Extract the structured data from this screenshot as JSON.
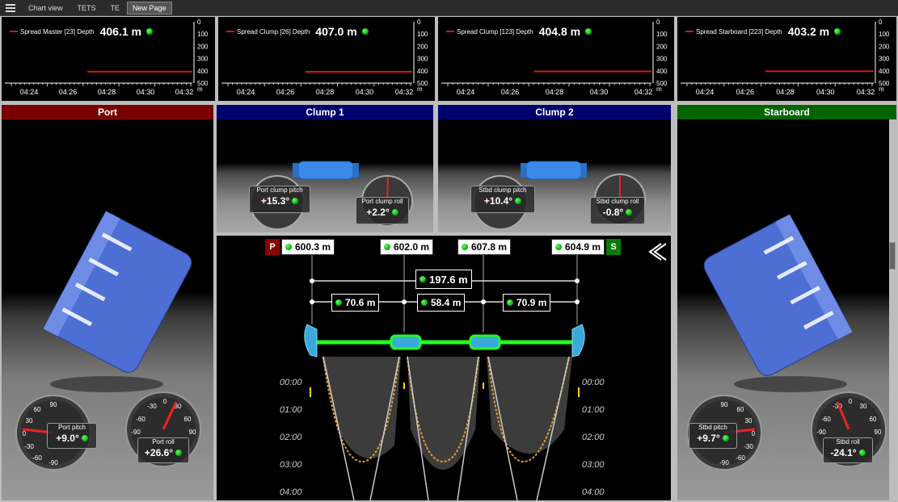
{
  "menu": {
    "tabs": [
      "Chart view",
      "TETS",
      "TE",
      "New Page"
    ],
    "active": "New Page"
  },
  "charts": [
    {
      "label": "Spread Master [23] Depth",
      "value": "406.1 m",
      "times": [
        "04:24",
        "04:26",
        "04:28",
        "04:30",
        "04:32"
      ],
      "yticks": [
        "0",
        "100",
        "200",
        "300",
        "400",
        "500"
      ],
      "unit": "m",
      "depth": 406.1
    },
    {
      "label": "Spread Clump [26] Depth",
      "value": "407.0 m",
      "times": [
        "04:24",
        "04:26",
        "04:28",
        "04:30",
        "04:32"
      ],
      "yticks": [
        "0",
        "100",
        "200",
        "300",
        "400",
        "500"
      ],
      "unit": "m",
      "depth": 407.0
    },
    {
      "label": "Spread Clump [123] Depth",
      "value": "404.8 m",
      "times": [
        "04:24",
        "04:26",
        "04:28",
        "04:30",
        "04:32"
      ],
      "yticks": [
        "0",
        "100",
        "200",
        "300",
        "400",
        "500"
      ],
      "unit": "m",
      "depth": 404.8
    },
    {
      "label": "Spread Starboard [223] Depth",
      "value": "403.2 m",
      "times": [
        "04:24",
        "04:26",
        "04:28",
        "04:30",
        "04:32"
      ],
      "yticks": [
        "0",
        "100",
        "200",
        "300",
        "400",
        "500"
      ],
      "unit": "m",
      "depth": 403.2
    }
  ],
  "sections": {
    "port": "Port",
    "clump1": "Clump 1",
    "clump2": "Clump 2",
    "starboard": "Starboard"
  },
  "colors": {
    "port": "#7a0000",
    "clump": "#00006e",
    "starboard": "#006400",
    "net_line": "#22ff22",
    "depth_line": "#d41a1a"
  },
  "gauges": {
    "port_clump_pitch": {
      "label": "Port clump pitch",
      "value": "+15.3°"
    },
    "port_clump_roll": {
      "label": "Port clump roll",
      "value": "+2.2°"
    },
    "stbd_clump_pitch": {
      "label": "Stbd clump pitch",
      "value": "+10.4°"
    },
    "stbd_clump_roll": {
      "label": "Stbd clump roll",
      "value": "-0.8°"
    },
    "port_pitch": {
      "label": "Port pitch",
      "value": "+9.0°"
    },
    "port_roll": {
      "label": "Port roll",
      "value": "+26.6°"
    },
    "stbd_pitch": {
      "label": "Stbd pitch",
      "value": "+9.7°"
    },
    "stbd_roll": {
      "label": "Stbd roll",
      "value": "-24.1°"
    }
  },
  "dial_ticks": {
    "pitch": [
      "90",
      "60",
      "30",
      "0",
      "-30",
      "-60",
      "-90"
    ],
    "roll": [
      "-30",
      "0",
      "30",
      "-60",
      "60",
      "-90",
      "90"
    ]
  },
  "distances": {
    "port_depth": "600.3 m",
    "clump1_depth": "602.0 m",
    "clump2_depth": "607.8 m",
    "stbd_depth": "604.9 m",
    "port_tag": "P",
    "stbd_tag": "S",
    "total_spread": "197.6 m",
    "port_to_clump1": "70.6 m",
    "clump1_to_clump2": "58.4 m",
    "clump2_to_stbd": "70.9 m"
  },
  "time_axis": [
    "00:00",
    "01:00",
    "02:00",
    "03:00",
    "04:00"
  ]
}
